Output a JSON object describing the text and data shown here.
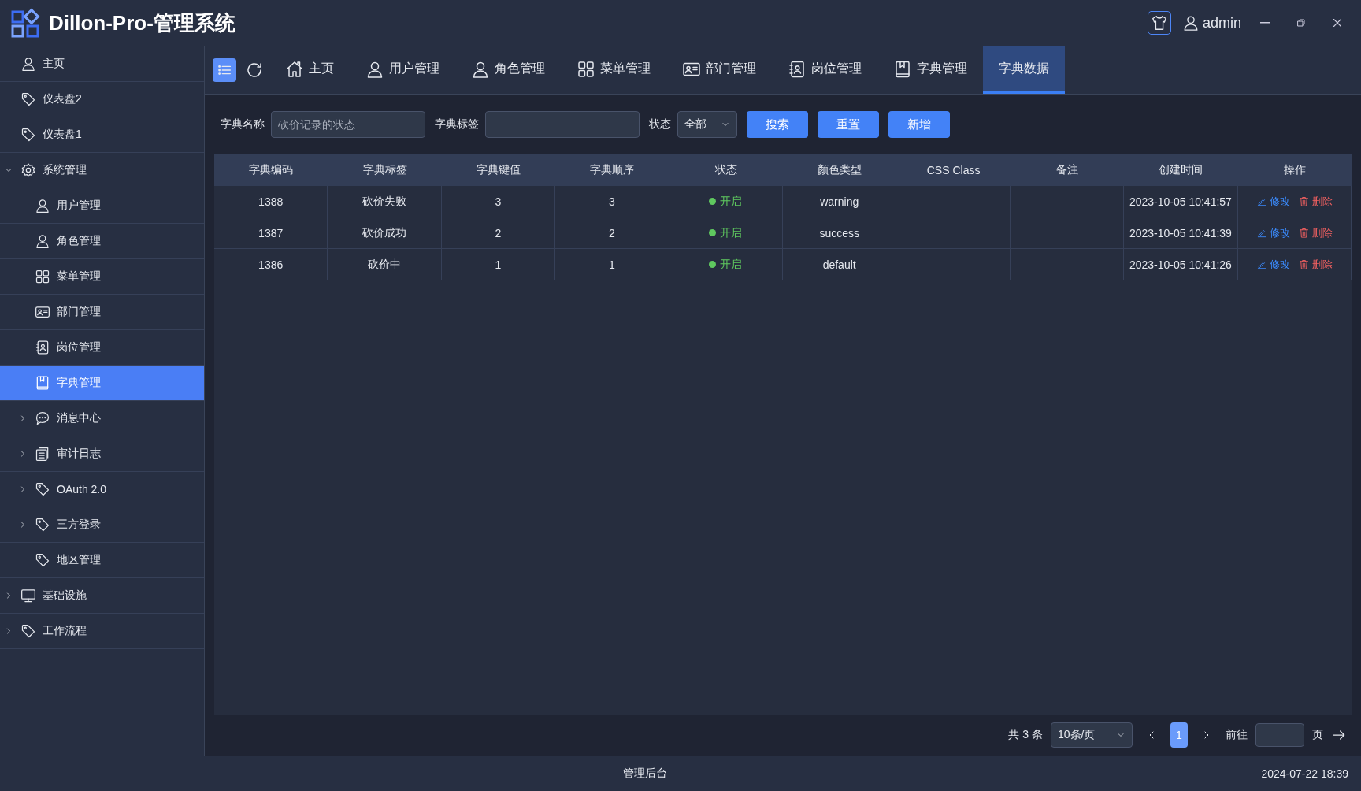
{
  "header": {
    "title": "Dillon-Pro-管理系统",
    "user": "admin"
  },
  "sidebar": {
    "items": [
      {
        "label": "主页",
        "kind": "user",
        "selected": false
      },
      {
        "label": "仪表盘2",
        "kind": "tag",
        "selected": false
      },
      {
        "label": "仪表盘1",
        "kind": "tag",
        "selected": false
      },
      {
        "label": "系统管理",
        "kind": "gear",
        "selected": false,
        "expanded": true,
        "children": [
          {
            "label": "用户管理",
            "kind": "user",
            "selected": false
          },
          {
            "label": "角色管理",
            "kind": "user",
            "selected": false
          },
          {
            "label": "菜单管理",
            "kind": "grid",
            "selected": false
          },
          {
            "label": "部门管理",
            "kind": "idcard",
            "selected": false
          },
          {
            "label": "岗位管理",
            "kind": "badge",
            "selected": false
          },
          {
            "label": "字典管理",
            "kind": "book",
            "selected": true
          },
          {
            "label": "消息中心",
            "kind": "chat",
            "selected": false,
            "expanded": false
          },
          {
            "label": "审计日志",
            "kind": "doc",
            "selected": false,
            "expanded": false
          },
          {
            "label": "OAuth 2.0",
            "kind": "tag",
            "selected": false,
            "expanded": false
          },
          {
            "label": "三方登录",
            "kind": "tag",
            "selected": false,
            "expanded": false
          },
          {
            "label": "地区管理",
            "kind": "tag",
            "selected": false
          }
        ]
      },
      {
        "label": "基础设施",
        "kind": "monitor",
        "selected": false,
        "expanded": false
      },
      {
        "label": "工作流程",
        "kind": "tag",
        "selected": false,
        "expanded": false
      }
    ]
  },
  "tabs": [
    {
      "label": "主页",
      "kind": "home",
      "selected": false
    },
    {
      "label": "用户管理",
      "kind": "user",
      "selected": false
    },
    {
      "label": "角色管理",
      "kind": "user",
      "selected": false
    },
    {
      "label": "菜单管理",
      "kind": "grid",
      "selected": false
    },
    {
      "label": "部门管理",
      "kind": "idcard",
      "selected": false
    },
    {
      "label": "岗位管理",
      "kind": "badge",
      "selected": false
    },
    {
      "label": "字典管理",
      "kind": "book",
      "selected": false
    },
    {
      "label": "字典数据",
      "selected": true
    }
  ],
  "filters": {
    "name_label": "字典名称",
    "name_placeholder": "砍价记录的状态",
    "tag_label": "字典标签",
    "status_label": "状态",
    "status_value": "全部",
    "buttons": [
      "搜索",
      "重置",
      "新增"
    ]
  },
  "table": {
    "columns": [
      "字典编码",
      "字典标签",
      "字典键值",
      "字典顺序",
      "状态",
      "颜色类型",
      "CSS Class",
      "备注",
      "创建时间",
      "操作"
    ],
    "rows": [
      {
        "code": "1388",
        "label": "砍价失败",
        "value": "3",
        "order": "3",
        "status": "开启",
        "enabled": true,
        "color_type": "warning",
        "css_class": "",
        "remark": "",
        "created": "2023-10-05 10:41:57",
        "actions": [
          "修改",
          "删除"
        ]
      },
      {
        "code": "1387",
        "label": "砍价成功",
        "value": "2",
        "order": "2",
        "status": "开启",
        "enabled": true,
        "color_type": "success",
        "css_class": "",
        "remark": "",
        "created": "2023-10-05 10:41:39",
        "actions": [
          "修改",
          "删除"
        ]
      },
      {
        "code": "1386",
        "label": "砍价中",
        "value": "1",
        "order": "1",
        "status": "开启",
        "enabled": true,
        "color_type": "default",
        "css_class": "",
        "remark": "",
        "created": "2023-10-05 10:41:26",
        "actions": [
          "修改",
          "删除"
        ]
      }
    ]
  },
  "pagination": {
    "total": "共 3 条",
    "page_size": "10条/页",
    "pages": [
      {
        "label": "1",
        "selected": true
      }
    ],
    "goto_label": "前往",
    "page_unit": "页"
  },
  "status_bar": {
    "center": "管理后台",
    "time": "2024-07-22 18:39"
  }
}
